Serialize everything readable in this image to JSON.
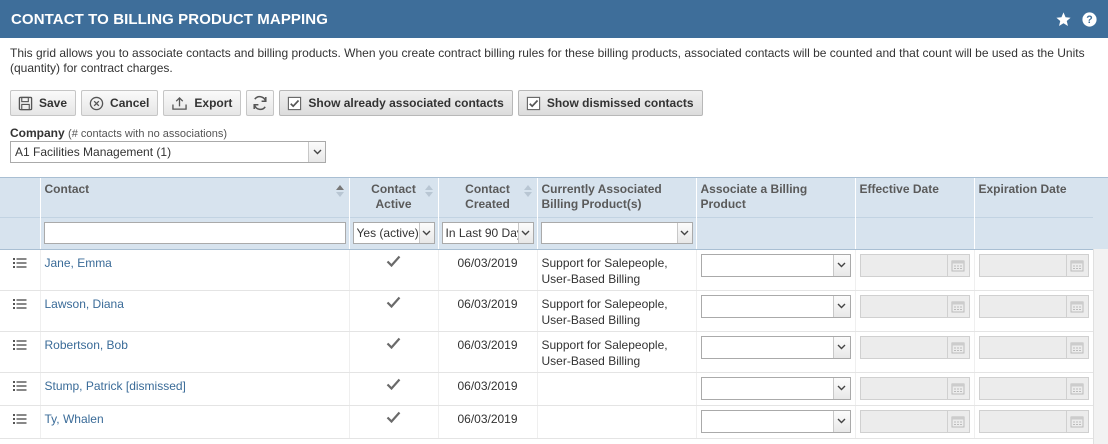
{
  "header": {
    "title": "CONTACT TO BILLING PRODUCT MAPPING",
    "icons": [
      "star-icon",
      "help-icon"
    ]
  },
  "description": "This grid allows you to associate contacts and billing products. When you create contract billing rules for these billing products, associated contacts will be counted and that count will be used as the Units (quantity) for contract charges.",
  "toolbar": {
    "save_label": "Save",
    "cancel_label": "Cancel",
    "export_label": "Export",
    "show_associated_label": "Show already associated contacts",
    "show_associated_checked": true,
    "show_dismissed_label": "Show dismissed contacts",
    "show_dismissed_checked": true
  },
  "company": {
    "label": "Company",
    "hint": "(# contacts with no associations)",
    "selected": "A1 Facilities Management (1)"
  },
  "columns": {
    "contact": "Contact",
    "active_line1": "Contact",
    "active_line2": "Active",
    "created_line1": "Contact",
    "created_line2": "Created",
    "current_products": "Currently Associated Billing Product(s)",
    "associate": "Associate a Billing Product",
    "effective": "Effective Date",
    "expiration": "Expiration Date"
  },
  "filters": {
    "contact_value": "",
    "active_value": "Yes (active)",
    "created_value": "In Last 90 Days",
    "current_value": ""
  },
  "rows": [
    {
      "name": "Jane, Emma",
      "active": true,
      "created": "06/03/2019",
      "products_line1": "Support for Salepeople,",
      "products_line2": "User-Based Billing"
    },
    {
      "name": "Lawson, Diana",
      "active": true,
      "created": "06/03/2019",
      "products_line1": "Support for Salepeople,",
      "products_line2": "User-Based Billing"
    },
    {
      "name": "Robertson, Bob",
      "active": true,
      "created": "06/03/2019",
      "products_line1": "Support for Salepeople,",
      "products_line2": "User-Based Billing"
    },
    {
      "name": "Stump, Patrick [dismissed]",
      "active": true,
      "created": "06/03/2019",
      "products_line1": "",
      "products_line2": ""
    },
    {
      "name": "Ty, Whalen",
      "active": true,
      "created": "06/03/2019",
      "products_line1": "",
      "products_line2": ""
    }
  ],
  "colors": {
    "header_bg": "#3e6e9a",
    "grid_header_bg": "#d7e3ee",
    "link": "#3a6b98"
  }
}
